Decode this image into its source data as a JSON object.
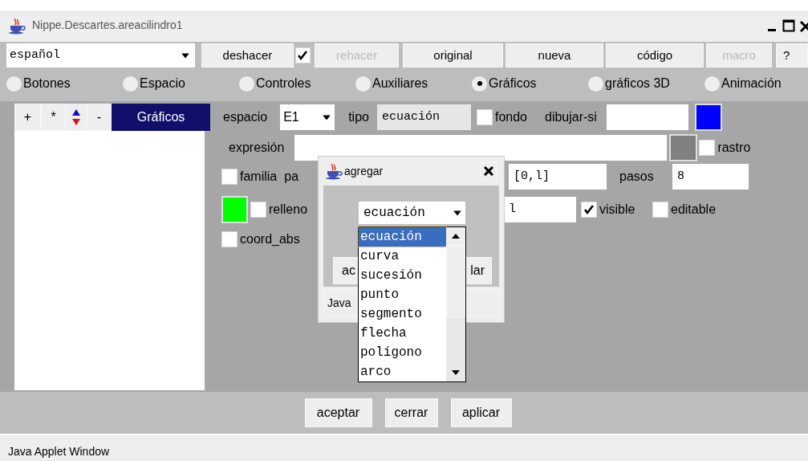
{
  "window": {
    "title": "Nippe.Descartes.areacilindro1"
  },
  "toolbar": {
    "language": "español",
    "items": [
      {
        "kind": "button",
        "label": "deshacer",
        "disabled": false
      },
      {
        "kind": "checkbox",
        "checked": true
      },
      {
        "kind": "button",
        "label": "rehacer",
        "disabled": true
      },
      {
        "kind": "button",
        "label": "original",
        "disabled": false
      },
      {
        "kind": "button",
        "label": "nueva",
        "disabled": false
      },
      {
        "kind": "button",
        "label": "código",
        "disabled": false
      },
      {
        "kind": "button",
        "label": "macro",
        "disabled": true
      },
      {
        "kind": "button",
        "label": "?",
        "disabled": false
      }
    ]
  },
  "tabs": [
    {
      "label": "Botones",
      "selected": false
    },
    {
      "label": "Espacio",
      "selected": false
    },
    {
      "label": "Controles",
      "selected": false
    },
    {
      "label": "Auxiliares",
      "selected": false
    },
    {
      "label": "Gráficos",
      "selected": true
    },
    {
      "label": "gráficos 3D",
      "selected": false
    },
    {
      "label": "Animación",
      "selected": false
    }
  ],
  "left_panel": {
    "buttons": [
      "+",
      "*",
      "-"
    ],
    "header": "Gráficos"
  },
  "form_rows": [
    [
      {
        "kind": "label",
        "text": "espacio"
      },
      {
        "kind": "select",
        "value": "E1"
      },
      {
        "kind": "label",
        "text": "tipo"
      },
      {
        "kind": "field",
        "value": "ecuación",
        "disabled": true
      },
      {
        "kind": "checkbox",
        "label": "fondo",
        "checked": false
      },
      {
        "kind": "label",
        "text": "dibujar-si"
      },
      {
        "kind": "field",
        "disabled": false
      },
      {
        "kind": "swatch",
        "color": "#0000ff"
      }
    ],
    [
      {
        "kind": "label",
        "text": "expresión"
      },
      {
        "kind": "field",
        "disabled": false
      },
      {
        "kind": "swatch",
        "color": "#808080"
      },
      {
        "kind": "checkbox",
        "label": "rastro",
        "checked": false
      }
    ],
    [
      {
        "kind": "checkbox",
        "label": "familia",
        "checked": false
      },
      {
        "kind": "label",
        "text": "pa"
      },
      {
        "kind": "field",
        "value": "[0,l]",
        "disabled": false
      },
      {
        "kind": "label",
        "text": "pasos"
      },
      {
        "kind": "field",
        "value": "8",
        "disabled": false
      }
    ],
    [
      {
        "kind": "swatch",
        "color": "#00ff00"
      },
      {
        "kind": "checkbox",
        "label": "relleno",
        "checked": false
      },
      {
        "kind": "field",
        "value": "l",
        "disabled": false
      },
      {
        "kind": "checkbox",
        "label": "visible",
        "checked": true
      },
      {
        "kind": "checkbox",
        "label": "editable",
        "checked": false
      }
    ],
    [
      {
        "kind": "checkbox",
        "label": "coord_abs",
        "checked": false
      }
    ]
  ],
  "dialog": {
    "title": "agregar",
    "select": "ecuación",
    "buttons": [
      "ac",
      "lar"
    ],
    "status": "Java",
    "options": [
      {
        "label": "ecuación",
        "selected": true
      },
      {
        "label": "curva",
        "selected": false
      },
      {
        "label": "sucesión",
        "selected": false
      },
      {
        "label": "punto",
        "selected": false
      },
      {
        "label": "segmento",
        "selected": false
      },
      {
        "label": "flecha",
        "selected": false
      },
      {
        "label": "polígono",
        "selected": false
      },
      {
        "label": "arco",
        "selected": false
      }
    ]
  },
  "footer_buttons": [
    "aceptar",
    "cerrar",
    "aplicar"
  ],
  "status_bar": "Java Applet Window"
}
